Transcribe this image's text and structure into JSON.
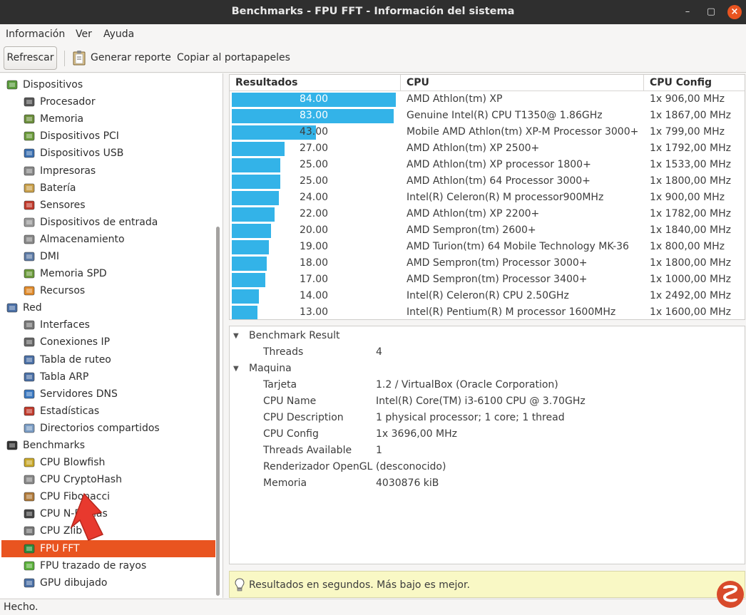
{
  "window": {
    "title": "Benchmarks - FPU FFT - Información del sistema",
    "minimize_glyph": "–",
    "maximize_glyph": "▢",
    "close_glyph": "×"
  },
  "menubar": [
    "Información",
    "Ver",
    "Ayuda"
  ],
  "toolbar": {
    "refresh_label": "Refrescar",
    "report_label": "Generar reporte",
    "copy_label": "Copiar al portapapeles"
  },
  "tree": {
    "items": [
      {
        "label": "Dispositivos",
        "level": 0,
        "icon": "chip-icon"
      },
      {
        "label": "Procesador",
        "level": 1,
        "icon": "cpu-icon"
      },
      {
        "label": "Memoria",
        "level": 1,
        "icon": "memory-icon"
      },
      {
        "label": "Dispositivos PCI",
        "level": 1,
        "icon": "pci-icon"
      },
      {
        "label": "Dispositivos USB",
        "level": 1,
        "icon": "usb-icon"
      },
      {
        "label": "Impresoras",
        "level": 1,
        "icon": "printer-icon"
      },
      {
        "label": "Batería",
        "level": 1,
        "icon": "battery-icon"
      },
      {
        "label": "Sensores",
        "level": 1,
        "icon": "thermometer-icon"
      },
      {
        "label": "Dispositivos de entrada",
        "level": 1,
        "icon": "keyboard-icon"
      },
      {
        "label": "Almacenamiento",
        "level": 1,
        "icon": "disk-icon"
      },
      {
        "label": "DMI",
        "level": 1,
        "icon": "monitor-icon"
      },
      {
        "label": "Memoria SPD",
        "level": 1,
        "icon": "spd-icon"
      },
      {
        "label": "Recursos",
        "level": 1,
        "icon": "resources-icon"
      },
      {
        "label": "Red",
        "level": 0,
        "icon": "network-icon"
      },
      {
        "label": "Interfaces",
        "level": 1,
        "icon": "interfaces-icon"
      },
      {
        "label": "Conexiones IP",
        "level": 1,
        "icon": "plug-icon"
      },
      {
        "label": "Tabla de ruteo",
        "level": 1,
        "icon": "routing-icon"
      },
      {
        "label": "Tabla ARP",
        "level": 1,
        "icon": "arp-icon"
      },
      {
        "label": "Servidores DNS",
        "level": 1,
        "icon": "globe-icon"
      },
      {
        "label": "Estadísticas",
        "level": 1,
        "icon": "stats-icon"
      },
      {
        "label": "Directorios compartidos",
        "level": 1,
        "icon": "folder-icon"
      },
      {
        "label": "Benchmarks",
        "level": 0,
        "icon": "benchmark-icon"
      },
      {
        "label": "CPU Blowfish",
        "level": 1,
        "icon": "blowfish-icon"
      },
      {
        "label": "CPU CryptoHash",
        "level": 1,
        "icon": "key-icon"
      },
      {
        "label": "CPU Fibonacci",
        "level": 1,
        "icon": "shell-icon"
      },
      {
        "label": "CPU N-Reinas",
        "level": 1,
        "icon": "chess-icon"
      },
      {
        "label": "CPU Zlib",
        "level": 1,
        "icon": "compress-icon"
      },
      {
        "label": "FPU FFT",
        "level": 1,
        "icon": "fft-icon",
        "selected": true
      },
      {
        "label": "FPU trazado de rayos",
        "level": 1,
        "icon": "raytrace-icon"
      },
      {
        "label": "GPU dibujado",
        "level": 1,
        "icon": "gpu-icon"
      }
    ]
  },
  "results": {
    "headers": [
      "Resultados",
      "CPU",
      "CPU Config"
    ],
    "max_bar_value": 84,
    "bar_color": "#33b3e8",
    "rows": [
      {
        "value": "84.00",
        "cpu": "AMD Athlon(tm) XP",
        "config": "1x 906,00 MHz"
      },
      {
        "value": "83.00",
        "cpu": "Genuine Intel(R) CPU T1350@ 1.86GHz",
        "config": "1x 1867,00 MHz"
      },
      {
        "value": "43.00",
        "cpu": "Mobile AMD Athlon(tm) XP-M Processor 3000+",
        "config": "1x 799,00 MHz"
      },
      {
        "value": "27.00",
        "cpu": "AMD Athlon(tm) XP 2500+",
        "config": "1x 1792,00 MHz"
      },
      {
        "value": "25.00",
        "cpu": "AMD Athlon(tm) XP processor 1800+",
        "config": "1x 1533,00 MHz"
      },
      {
        "value": "25.00",
        "cpu": "AMD Athlon(tm) 64 Processor 3000+",
        "config": "1x 1800,00 MHz"
      },
      {
        "value": "24.00",
        "cpu": "Intel(R) Celeron(R) M processor900MHz",
        "config": "1x 900,00 MHz"
      },
      {
        "value": "22.00",
        "cpu": "AMD Athlon(tm) XP 2200+",
        "config": "1x 1782,00 MHz"
      },
      {
        "value": "20.00",
        "cpu": "AMD Sempron(tm) 2600+",
        "config": "1x 1840,00 MHz"
      },
      {
        "value": "19.00",
        "cpu": "AMD Turion(tm) 64 Mobile Technology MK-36",
        "config": "1x 800,00 MHz"
      },
      {
        "value": "18.00",
        "cpu": "AMD Sempron(tm) Processor 3000+",
        "config": "1x 1800,00 MHz"
      },
      {
        "value": "17.00",
        "cpu": "AMD Sempron(tm) Processor 3400+",
        "config": "1x 1000,00 MHz"
      },
      {
        "value": "14.00",
        "cpu": "Intel(R) Celeron(R) CPU 2.50GHz",
        "config": "1x 2492,00 MHz"
      },
      {
        "value": "13.00",
        "cpu": "Intel(R) Pentium(R) M processor 1600MHz",
        "config": "1x 1600,00 MHz"
      }
    ]
  },
  "details": {
    "sections": [
      {
        "title": "Benchmark Result",
        "rows": [
          {
            "key": "Threads",
            "value": "4"
          }
        ]
      },
      {
        "title": "Maquina",
        "rows": [
          {
            "key": "Tarjeta",
            "value": "1.2 / VirtualBox (Oracle Corporation)"
          },
          {
            "key": "CPU Name",
            "value": "Intel(R) Core(TM) i3-6100 CPU @ 3.70GHz"
          },
          {
            "key": "CPU Description",
            "value": "1 physical processor; 1 core; 1 thread"
          },
          {
            "key": "CPU Config",
            "value": "1x 3696,00 MHz"
          },
          {
            "key": "Threads Available",
            "value": "1"
          },
          {
            "key": "Renderizador OpenGL",
            "value": "(desconocido)"
          },
          {
            "key": "Memoria",
            "value": "4030876 kiB"
          }
        ]
      }
    ]
  },
  "infobar": {
    "text": "Resultados en segundos. Más bajo es mejor."
  },
  "statusbar": {
    "text": "Hecho."
  },
  "colors": {
    "accent": "#e95420",
    "bar": "#33b3e8",
    "info_bg": "#f9f8c5"
  }
}
